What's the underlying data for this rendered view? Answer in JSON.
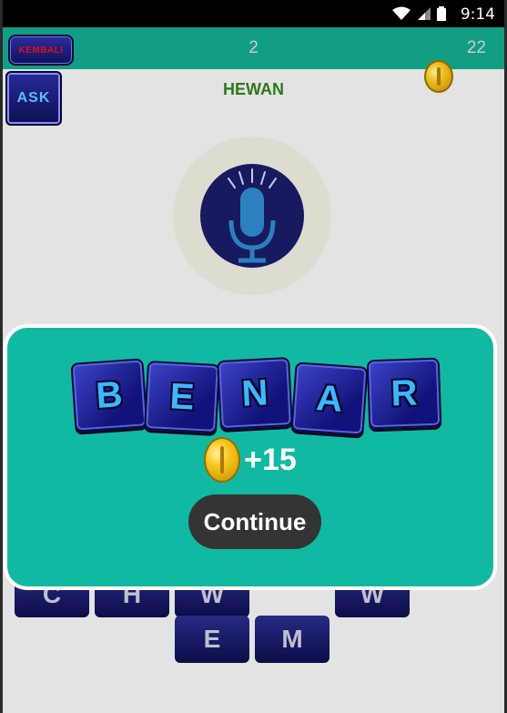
{
  "status": {
    "time": "9:14"
  },
  "header": {
    "back_label": "KEMBALI",
    "level": "2",
    "coins": "22"
  },
  "ask_label": "ASK",
  "category": "HEWAN",
  "tiles": {
    "row2": [
      "E",
      "M"
    ],
    "row1_partial": [
      "C",
      "H",
      "W",
      "W"
    ]
  },
  "dialog": {
    "letters": [
      "B",
      "E",
      "N",
      "A",
      "R"
    ],
    "reward": "+15",
    "continue_label": "Continue"
  },
  "colors": {
    "accent": "#12b9a2",
    "topbar": "#12a58a",
    "category": "#2e7d1c"
  }
}
